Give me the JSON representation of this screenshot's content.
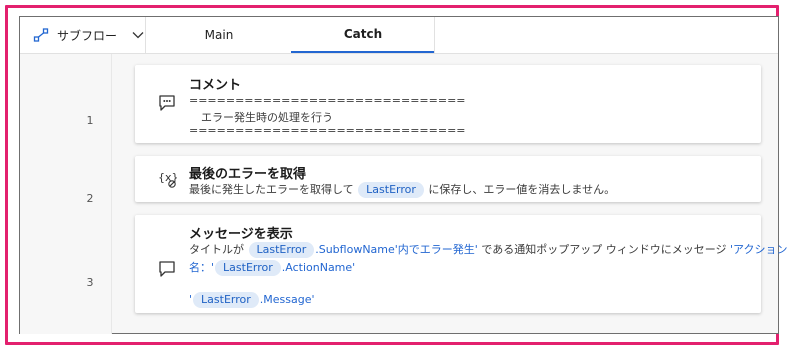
{
  "subflow": {
    "label": "サブフロー"
  },
  "tabs": [
    {
      "label": "Main",
      "active": false
    },
    {
      "label": "Catch",
      "active": true
    }
  ],
  "steps": [
    {
      "number": "1",
      "title": "コメント",
      "separator": "==============================",
      "comment": "エラー発生時の処理を行う"
    },
    {
      "number": "2",
      "title": "最後のエラーを取得",
      "desc_pre": "最後に発生したエラーを取得して",
      "var": "LastError",
      "desc_post": "に保存し、エラー値を消去しません。"
    },
    {
      "number": "3",
      "title": "メッセージを表示",
      "line1_pre": "タイトルが",
      "line1_var": "LastError",
      "line1_str": ".SubflowName'内でエラー発生'",
      "line1_mid": "である通知ポップアップ ウィンドウにメッセージ",
      "line1_str2": "'アクション",
      "line2_str": "名：'",
      "line2_var": "LastError",
      "line2_post": ".ActionName'",
      "line3_pre": "'",
      "line3_var": "LastError",
      "line3_post": ".Message'"
    }
  ],
  "colors": {
    "accent": "#2266d1",
    "frame": "#e3206e",
    "var_bg": "#dfeaf8"
  }
}
